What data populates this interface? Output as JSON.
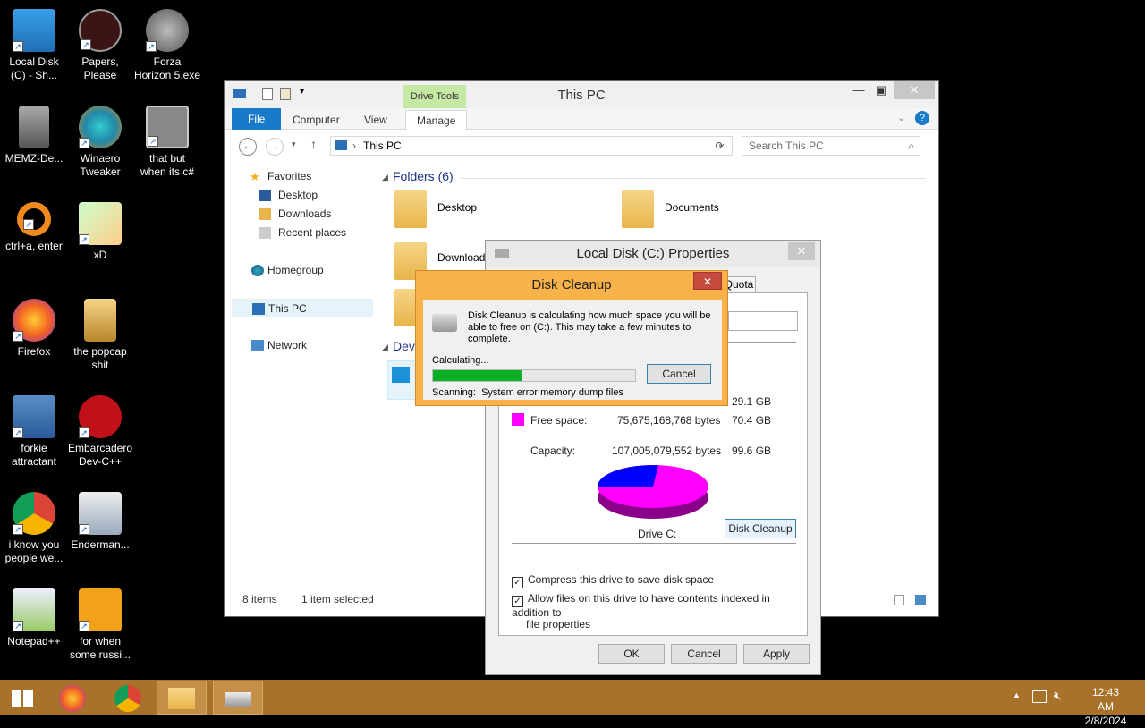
{
  "desktop": {
    "icons": [
      {
        "label_line1": "Local Disk",
        "label_line2": "(C) - Sh..."
      },
      {
        "label_line1": "Papers,",
        "label_line2": "Please"
      },
      {
        "label_line1": "Forza",
        "label_line2": "Horizon 5.exe"
      },
      {
        "label_line1": "MEMZ-De...",
        "label_line2": ""
      },
      {
        "label_line1": "Winaero",
        "label_line2": "Tweaker"
      },
      {
        "label_line1": "that but",
        "label_line2": "when its c#"
      },
      {
        "label_line1": "ctrl+a, enter",
        "label_line2": ""
      },
      {
        "label_line1": "xD",
        "label_line2": ""
      },
      {
        "label_line1": "Firefox",
        "label_line2": ""
      },
      {
        "label_line1": "the popcap",
        "label_line2": "shit"
      },
      {
        "label_line1": "forkie",
        "label_line2": "attractant"
      },
      {
        "label_line1": "Embarcadero",
        "label_line2": "Dev-C++"
      },
      {
        "label_line1": "i know you",
        "label_line2": "people we..."
      },
      {
        "label_line1": "Enderman...",
        "label_line2": ""
      },
      {
        "label_line1": "Notepad++",
        "label_line2": ""
      },
      {
        "label_line1": "for when",
        "label_line2": "some russi..."
      }
    ]
  },
  "explorer": {
    "title": "This PC",
    "drive_tools": "Drive Tools",
    "tabs": {
      "file": "File",
      "computer": "Computer",
      "view": "View",
      "manage": "Manage"
    },
    "address": "This PC",
    "search_placeholder": "Search This PC",
    "nav": {
      "favorites": "Favorites",
      "desktop": "Desktop",
      "downloads": "Downloads",
      "recent": "Recent places",
      "homegroup": "Homegroup",
      "thispc": "This PC",
      "network": "Network"
    },
    "folders_header": "Folders (6)",
    "folder_desktop": "Desktop",
    "folder_documents": "Documents",
    "folder_downloads": "Download",
    "devices_header": "Dev",
    "status_items": "8 items",
    "status_selected": "1 item selected"
  },
  "properties": {
    "title": "Local Disk (C:) Properties",
    "quota_tab": "Quota",
    "used_gb": "29.1 GB",
    "free_label": "Free space:",
    "free_bytes": "75,675,168,768 bytes",
    "free_gb": "70.4 GB",
    "capacity_label": "Capacity:",
    "capacity_bytes": "107,005,079,552 bytes",
    "capacity_gb": "99.6 GB",
    "drive_label": "Drive C:",
    "disk_cleanup_button": "Disk Cleanup",
    "compress_label": "Compress this drive to save disk space",
    "index_label_1": "Allow files on this drive to have contents indexed in addition to",
    "index_label_2": "file properties",
    "ok": "OK",
    "cancel": "Cancel",
    "apply": "Apply",
    "colors": {
      "used": "#0000ff",
      "free": "#ff00ff"
    }
  },
  "cleanup": {
    "title": "Disk Cleanup",
    "msg1": "Disk Cleanup is calculating how much space you will be",
    "msg2": "able to free on  (C:). This may take a few minutes to",
    "msg3": "complete.",
    "calculating": "Calculating...",
    "cancel": "Cancel",
    "scanning_label": "Scanning:",
    "scanning_value": "System error memory dump files",
    "progress": 0.44
  },
  "taskbar": {
    "time": "12:43 AM",
    "date": "2/8/2024"
  }
}
